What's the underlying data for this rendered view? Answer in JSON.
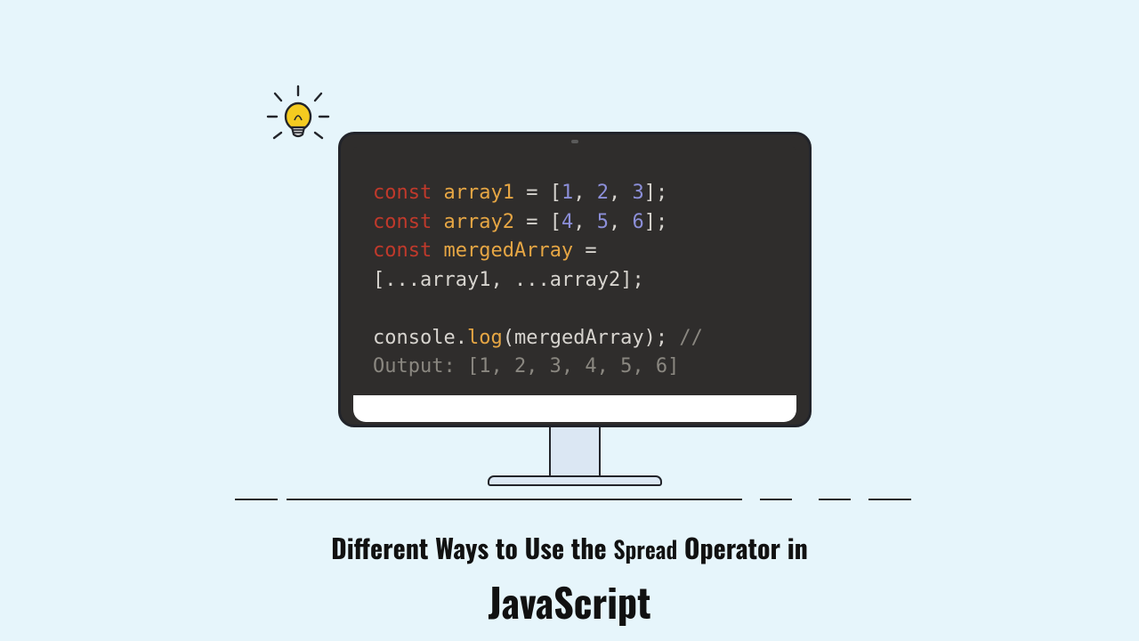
{
  "code": {
    "l1": {
      "const": "const",
      "name": "array1",
      "eq": " = ",
      "open": "[",
      "v1": "1",
      "c": ", ",
      "v2": "2",
      "v3": "3",
      "close": "];"
    },
    "l2": {
      "const": "const",
      "name": "array2",
      "eq": " = ",
      "open": "[",
      "v1": "4",
      "c": ", ",
      "v2": "5",
      "v3": "6",
      "close": "];"
    },
    "l3": {
      "const": "const",
      "name": "mergedArray",
      "eq": " ="
    },
    "l4": {
      "open": "[",
      "dots1": "...",
      "a": "array1",
      "comma": ", ",
      "dots2": "...",
      "b": "array2",
      "close": "];"
    },
    "l6": {
      "obj": "console",
      "dot": ".",
      "fn": "log",
      "open": "(",
      "arg": "mergedArray",
      "close": ");",
      "slashes": " //"
    },
    "l7": {
      "text": "Output: [1, 2, 3, 4, 5, 6]"
    }
  },
  "title": {
    "line1a": "Different Ways to Use the ",
    "line1b": "Spread",
    "line1c": " Operator in",
    "line2": "JavaScript"
  }
}
